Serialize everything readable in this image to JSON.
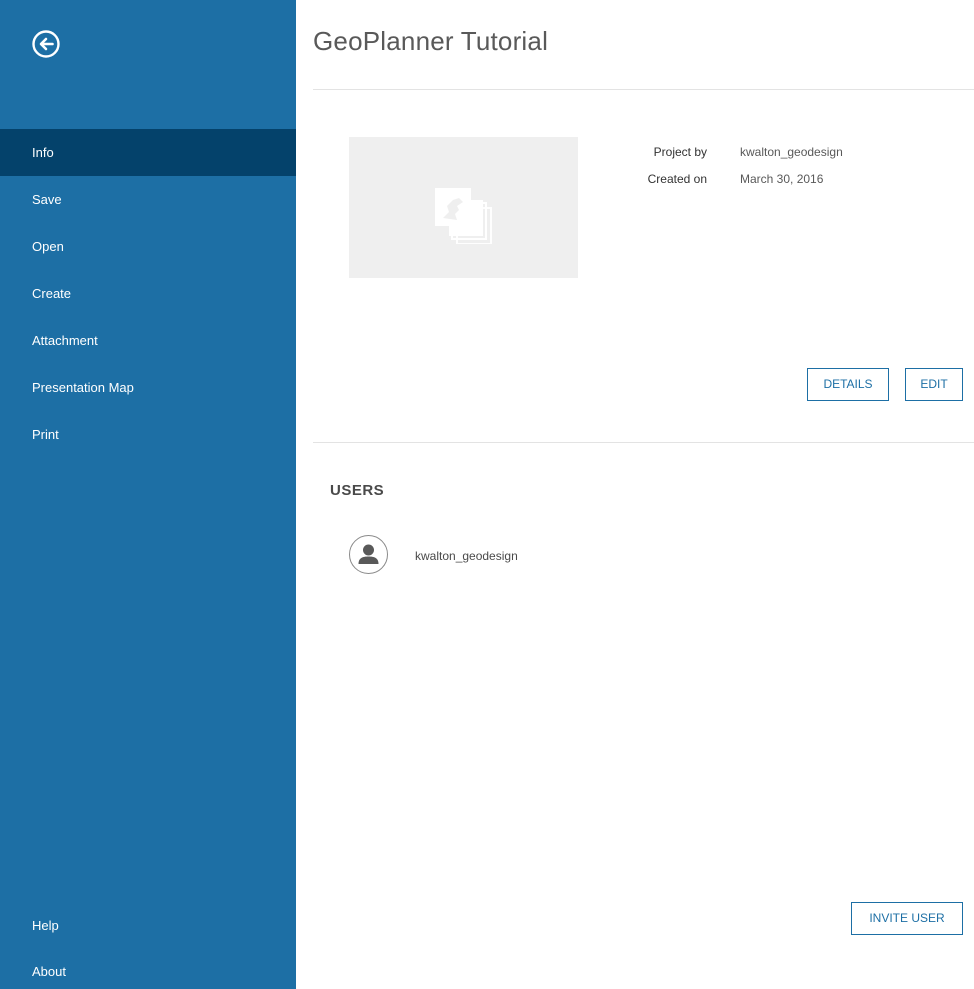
{
  "header": {
    "title": "GeoPlanner Tutorial"
  },
  "sidebar": {
    "back_icon": "arrow-left-circle-icon",
    "items": [
      {
        "label": "Info",
        "active": true
      },
      {
        "label": "Save"
      },
      {
        "label": "Open"
      },
      {
        "label": "Create"
      },
      {
        "label": "Attachment"
      },
      {
        "label": "Presentation Map"
      },
      {
        "label": "Print"
      }
    ],
    "bottom_items": [
      {
        "label": "Help"
      },
      {
        "label": "About"
      }
    ]
  },
  "project": {
    "thumbnail_icon": "map-stack-icon",
    "project_by_label": "Project by",
    "project_by_value": "kwalton_geodesign",
    "created_on_label": "Created on",
    "created_on_value": "March 30, 2016",
    "details_button": "DETAILS",
    "edit_button": "EDIT"
  },
  "users": {
    "title": "USERS",
    "list": [
      {
        "name": "kwalton_geodesign",
        "avatar_icon": "user-avatar-icon"
      }
    ],
    "invite_button": "INVITE USER"
  },
  "colors": {
    "sidebar_bg": "#1d6fa5",
    "sidebar_active": "#04426b",
    "accent": "#1d6fa5"
  }
}
